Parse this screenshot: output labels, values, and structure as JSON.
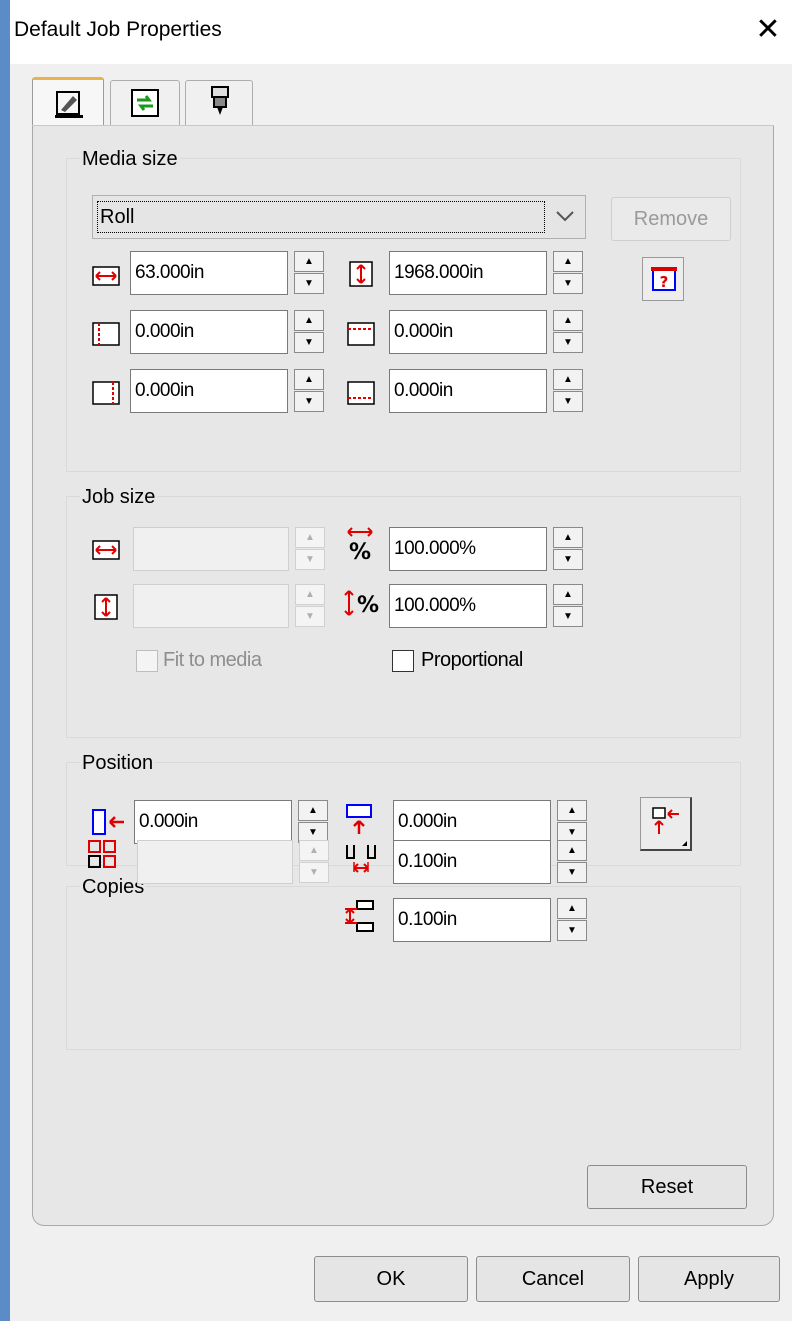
{
  "window": {
    "title": "Default Job Properties"
  },
  "tabs": [
    {
      "icon": "media-layout-icon",
      "active": true
    },
    {
      "icon": "color-swap-icon",
      "active": false
    },
    {
      "icon": "print-head-icon",
      "active": false
    }
  ],
  "media_size": {
    "label": "Media size",
    "dropdown_value": "Roll",
    "remove_label": "Remove",
    "width": "63.000in",
    "height": "1968.000in",
    "margin_left": "0.000in",
    "margin_top": "0.000in",
    "margin_right": "0.000in",
    "margin_bottom": "0.000in"
  },
  "job_size": {
    "label": "Job size",
    "width": "",
    "height": "",
    "scale_x": "100.000%",
    "scale_y": "100.000%",
    "fit_label": "Fit to media",
    "proportional_label": "Proportional"
  },
  "position": {
    "label": "Position",
    "x": "0.000in",
    "y": "0.000in"
  },
  "copies": {
    "label": "Copies",
    "count": "",
    "spacing_h": "0.100in",
    "spacing_v": "0.100in"
  },
  "buttons": {
    "reset": "Reset",
    "ok": "OK",
    "cancel": "Cancel",
    "apply": "Apply"
  },
  "colors": {
    "icon_red": "#e00000",
    "icon_blue": "#0000ff",
    "tab_highlight": "#e8b34b",
    "window_border": "#5b8cc8"
  }
}
